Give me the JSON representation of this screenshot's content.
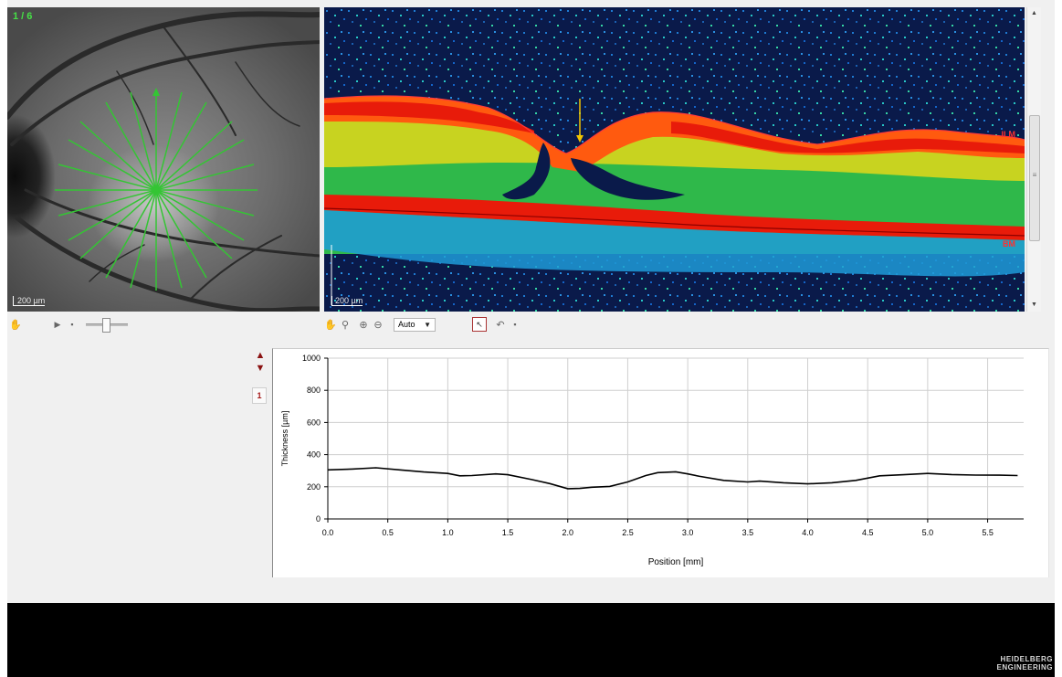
{
  "fundus": {
    "image_counter": "1 / 6",
    "scale_label": "200 µm"
  },
  "oct": {
    "scale_label": "200 µm",
    "layer_top_label": "ILM",
    "layer_bottom_label": "BM"
  },
  "toolbar_left": {
    "icons": [
      "hand-icon",
      "play-icon",
      "save-icon",
      "slider"
    ]
  },
  "toolbar_right": {
    "zoom_value": "Auto",
    "icons": [
      "hand-icon",
      "magnifier-icon",
      "zoom-in-icon",
      "zoom-out-icon",
      "select-tool-icon",
      "undo-icon",
      "save-icon"
    ]
  },
  "side": {
    "selected_index": "1"
  },
  "colors": {
    "chart_line": "#000000",
    "footer": "#000000",
    "fundus_overlay": "#34c534",
    "accent_red": "#8a1111"
  },
  "chart_data": {
    "type": "line",
    "xlabel": "Position [mm]",
    "ylabel": "Thickness [µm]",
    "xlim": [
      0,
      5.8
    ],
    "ylim": [
      0,
      1000
    ],
    "xticks": [
      0.0,
      0.5,
      1.0,
      1.5,
      2.0,
      2.5,
      3.0,
      3.5,
      4.0,
      4.5,
      5.0,
      5.5
    ],
    "xtick_labels": [
      "0.0",
      "0.5",
      "1.0",
      "1.5",
      "2.0",
      "2.5",
      "3.0",
      "3.5",
      "4.0",
      "4.5",
      "5.0",
      "5.5"
    ],
    "yticks": [
      0,
      200,
      400,
      600,
      800,
      1000
    ],
    "ytick_labels": [
      "0",
      "200",
      "400",
      "600",
      "800",
      "1000"
    ],
    "grid": true,
    "series": [
      {
        "x": [
          0.0,
          0.2,
          0.4,
          0.6,
          0.8,
          1.0,
          1.1,
          1.2,
          1.4,
          1.5,
          1.7,
          1.85,
          2.0,
          2.1,
          2.2,
          2.35,
          2.5,
          2.65,
          2.75,
          2.9,
          3.0,
          3.1,
          3.3,
          3.5,
          3.6,
          3.8,
          4.0,
          4.2,
          4.4,
          4.6,
          4.8,
          5.0,
          5.2,
          5.4,
          5.6,
          5.75
        ],
        "y": [
          305,
          310,
          318,
          305,
          292,
          283,
          268,
          270,
          280,
          275,
          245,
          220,
          188,
          190,
          197,
          202,
          230,
          270,
          288,
          293,
          280,
          265,
          240,
          230,
          235,
          225,
          218,
          225,
          240,
          268,
          275,
          283,
          276,
          273,
          272,
          270
        ]
      }
    ]
  },
  "branding": {
    "line1": "HEIDELBERG",
    "line2": "ENGINEERING"
  }
}
